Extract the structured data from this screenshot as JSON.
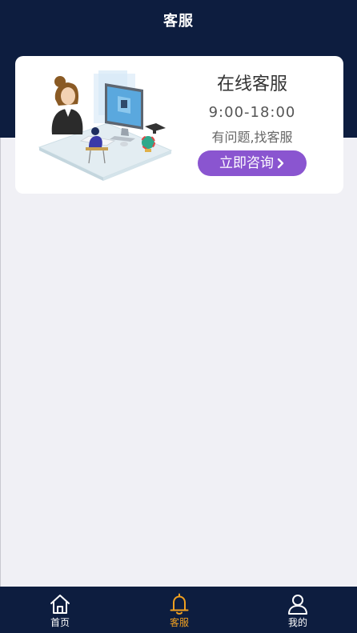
{
  "header": {
    "title": "客服"
  },
  "service_card": {
    "title": "在线客服",
    "hours": "9:00-18:00",
    "description": "有问题,找客服",
    "button_label": "立即咨询",
    "button_icon": "chevron-right-icon",
    "illustration": "customer-service-agent-illustration"
  },
  "tabbar": {
    "items": [
      {
        "label": "首页",
        "icon": "home-icon",
        "active": false
      },
      {
        "label": "客服",
        "icon": "bell-icon",
        "active": true
      },
      {
        "label": "我的",
        "icon": "user-icon",
        "active": false
      }
    ]
  },
  "colors": {
    "header_bg": "#0d1d3f",
    "page_bg": "#f0f0f5",
    "button_bg": "#8a55d0",
    "active_tab": "#f0a020"
  }
}
